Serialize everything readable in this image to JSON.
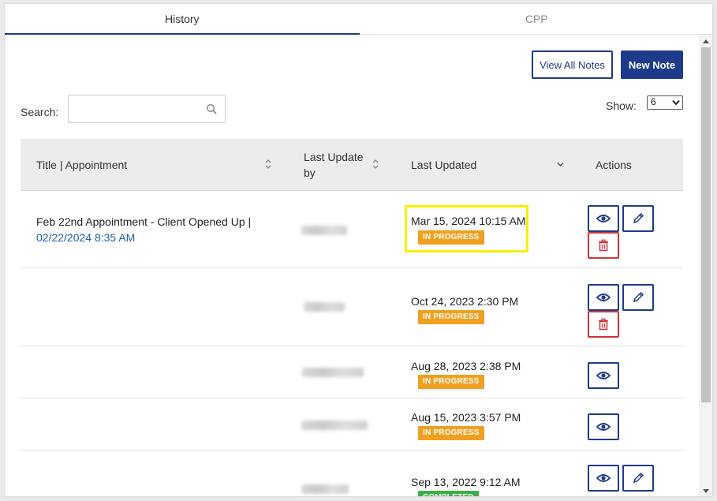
{
  "tabs": [
    {
      "label": "History",
      "active": true
    },
    {
      "label": "CPP",
      "active": false
    }
  ],
  "toolbar": {
    "view_all_notes": "View All Notes",
    "new_note": "New Note"
  },
  "search": {
    "label": "Search:",
    "value": "",
    "placeholder": ""
  },
  "show": {
    "label": "Show:",
    "selected": "6"
  },
  "table": {
    "headers": {
      "title": "Title | Appointment",
      "last_update_by_1": "Last Update",
      "last_update_by_2": "by",
      "last_updated": "Last Updated",
      "actions": "Actions"
    },
    "rows": [
      {
        "title": "Feb 22nd Appointment - Client Opened Up |",
        "appointment": "02/22/2024 8:35 AM",
        "last_updated": "Mar 15, 2024 10:15 AM",
        "status": "IN PROGRESS",
        "highlighted": true,
        "actions": [
          "view",
          "edit",
          "delete"
        ]
      },
      {
        "title": "",
        "appointment": "",
        "last_updated": "Oct 24, 2023 2:30 PM",
        "status": "IN PROGRESS",
        "highlighted": false,
        "actions": [
          "view",
          "edit",
          "delete"
        ]
      },
      {
        "title": "",
        "appointment": "",
        "last_updated": "Aug 28, 2023 2:38 PM",
        "status": "IN PROGRESS",
        "highlighted": false,
        "actions": [
          "view"
        ]
      },
      {
        "title": "",
        "appointment": "",
        "last_updated": "Aug 15, 2023 3:57 PM",
        "status": "IN PROGRESS",
        "highlighted": false,
        "actions": [
          "view"
        ]
      },
      {
        "title": "",
        "appointment": "",
        "last_updated": "Sep 13, 2022 9:12 AM",
        "status": "COMPLETED",
        "highlighted": false,
        "actions": [
          "view",
          "edit"
        ]
      }
    ]
  },
  "colors": {
    "primary": "#1e3a8a",
    "link": "#1e5fa8",
    "in_progress": "#f0a020",
    "completed": "#3fae49",
    "delete": "#d13438",
    "highlight": "#f7f000"
  },
  "icons": [
    "search-icon",
    "sort-icon",
    "chevron-down-icon",
    "eye-icon",
    "pencil-icon",
    "trash-icon"
  ]
}
